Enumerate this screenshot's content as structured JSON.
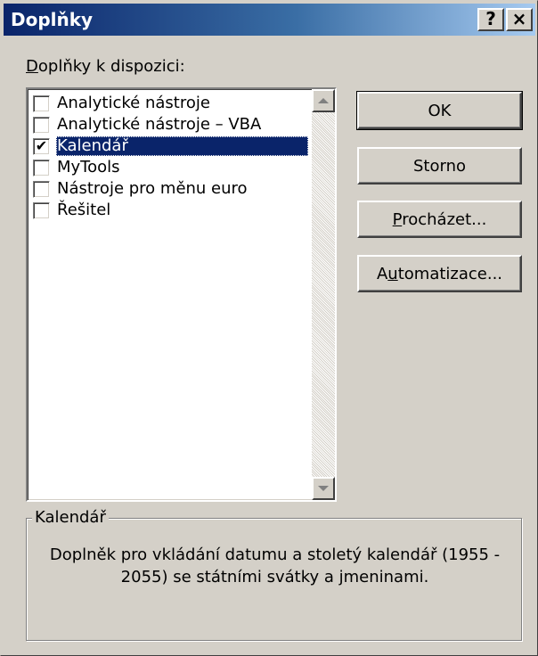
{
  "window": {
    "title": "Doplňky",
    "help_button": "?",
    "close_button": "×"
  },
  "list": {
    "label_accel": "D",
    "label_rest": "oplňky k dispozici:",
    "items": [
      {
        "label": "Analytické nástroje",
        "checked": false,
        "selected": false
      },
      {
        "label": "Analytické nástroje – VBA",
        "checked": false,
        "selected": false
      },
      {
        "label": "Kalendář",
        "checked": true,
        "selected": true
      },
      {
        "label": "MyTools",
        "checked": false,
        "selected": false
      },
      {
        "label": "Nástroje pro měnu euro",
        "checked": false,
        "selected": false
      },
      {
        "label": "Řešitel",
        "checked": false,
        "selected": false
      }
    ]
  },
  "buttons": {
    "ok": "OK",
    "cancel": "Storno",
    "browse_accel": "P",
    "browse_rest": "rocházet...",
    "auto_pre": "A",
    "auto_accel": "u",
    "auto_rest": "tomatizace..."
  },
  "description": {
    "title": "Kalendář",
    "text": "Doplněk pro vkládání datumu a stoletý kalendář (1955 - 2055) se státními svátky a jmeninami."
  },
  "colors": {
    "face": "#d4d0c8",
    "selection": "#0a246a",
    "title_start": "#0a246a",
    "title_end": "#a6caf0"
  }
}
